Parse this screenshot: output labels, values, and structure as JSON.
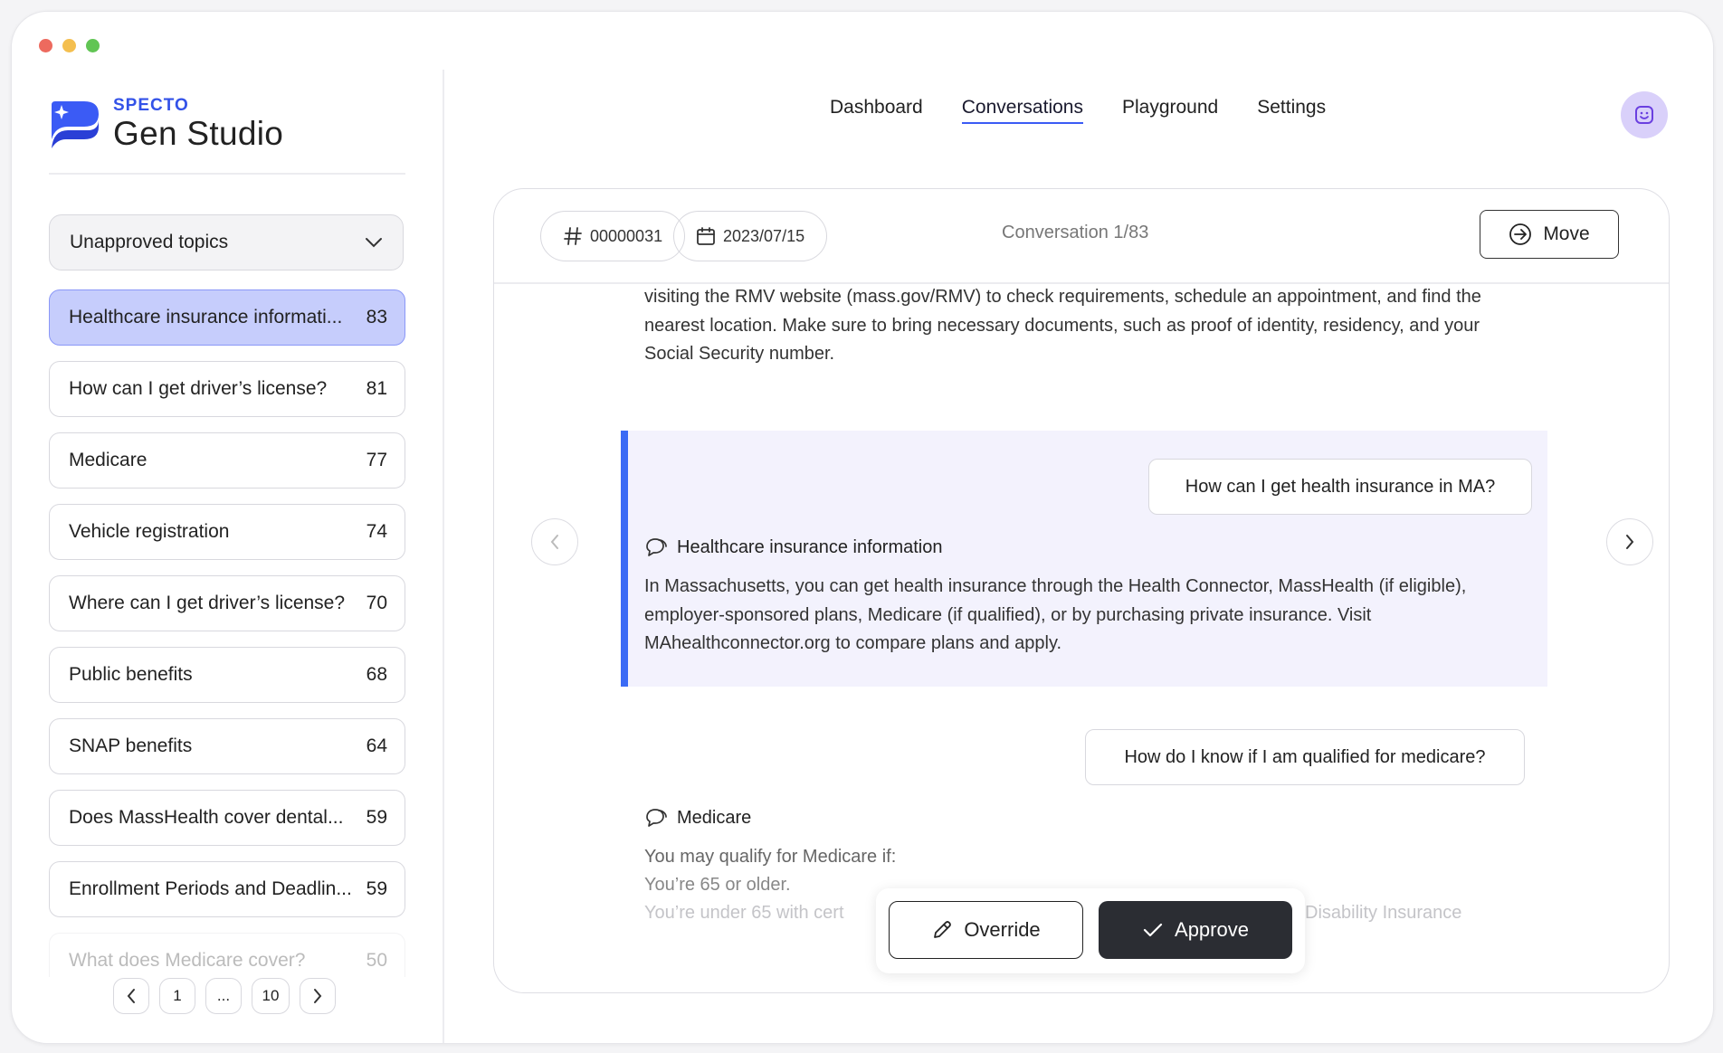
{
  "window": {
    "traffic_colors": [
      "#ed6a5e",
      "#f4bf4f",
      "#61c554"
    ]
  },
  "brand": {
    "small": "SPECTO",
    "big": "Gen Studio",
    "accent": "#3352e8"
  },
  "sidebar": {
    "filter_label": "Unapproved topics",
    "topics": [
      {
        "label": "Healthcare insurance informati...",
        "count": "83"
      },
      {
        "label": "How can I get driver’s license?",
        "count": "81"
      },
      {
        "label": "Medicare",
        "count": "77"
      },
      {
        "label": "Vehicle registration",
        "count": "74"
      },
      {
        "label": "Where can I get driver’s license?",
        "count": "70"
      },
      {
        "label": "Public benefits",
        "count": "68"
      },
      {
        "label": "SNAP benefits",
        "count": "64"
      },
      {
        "label": "Does MassHealth cover dental...",
        "count": "59"
      },
      {
        "label": "Enrollment Periods and Deadlin...",
        "count": "59"
      },
      {
        "label": "What does Medicare cover?",
        "count": "50"
      }
    ],
    "pagination": {
      "first": "1",
      "ellipsis": "...",
      "last": "10"
    }
  },
  "nav": {
    "tabs": [
      "Dashboard",
      "Conversations",
      "Playground",
      "Settings"
    ],
    "active": "Conversations"
  },
  "conversation": {
    "id": "00000031",
    "date": "2023/07/15",
    "position": "Conversation 1/83",
    "move_label": "Move",
    "prev_answer": "visiting the RMV website (mass.gov/RMV) to check requirements, schedule an appointment, and find the nearest location. Make sure to bring necessary documents, such as proof of identity, residency, and your Social Security number.",
    "q1": "How can I get health insurance in MA?",
    "t1": "Healthcare insurance information",
    "a1": "In Massachusetts, you can get health insurance through the Health Connector, MassHealth (if eligible), employer-sponsored plans, Medicare (if qualified), or by purchasing private insurance. Visit MAhealthconnector.org to compare plans and apply.",
    "q2": "How do I know if I am qualified for medicare?",
    "t2": "Medicare",
    "a2_line1": "You may qualify for Medicare if:",
    "a2_line2": "You’re 65 or older.",
    "a2_line3a": "You’re under 65 with cert",
    "a2_line3b": "Disability Insurance"
  },
  "actions": {
    "override_label": "Override",
    "approve_label": "Approve"
  }
}
